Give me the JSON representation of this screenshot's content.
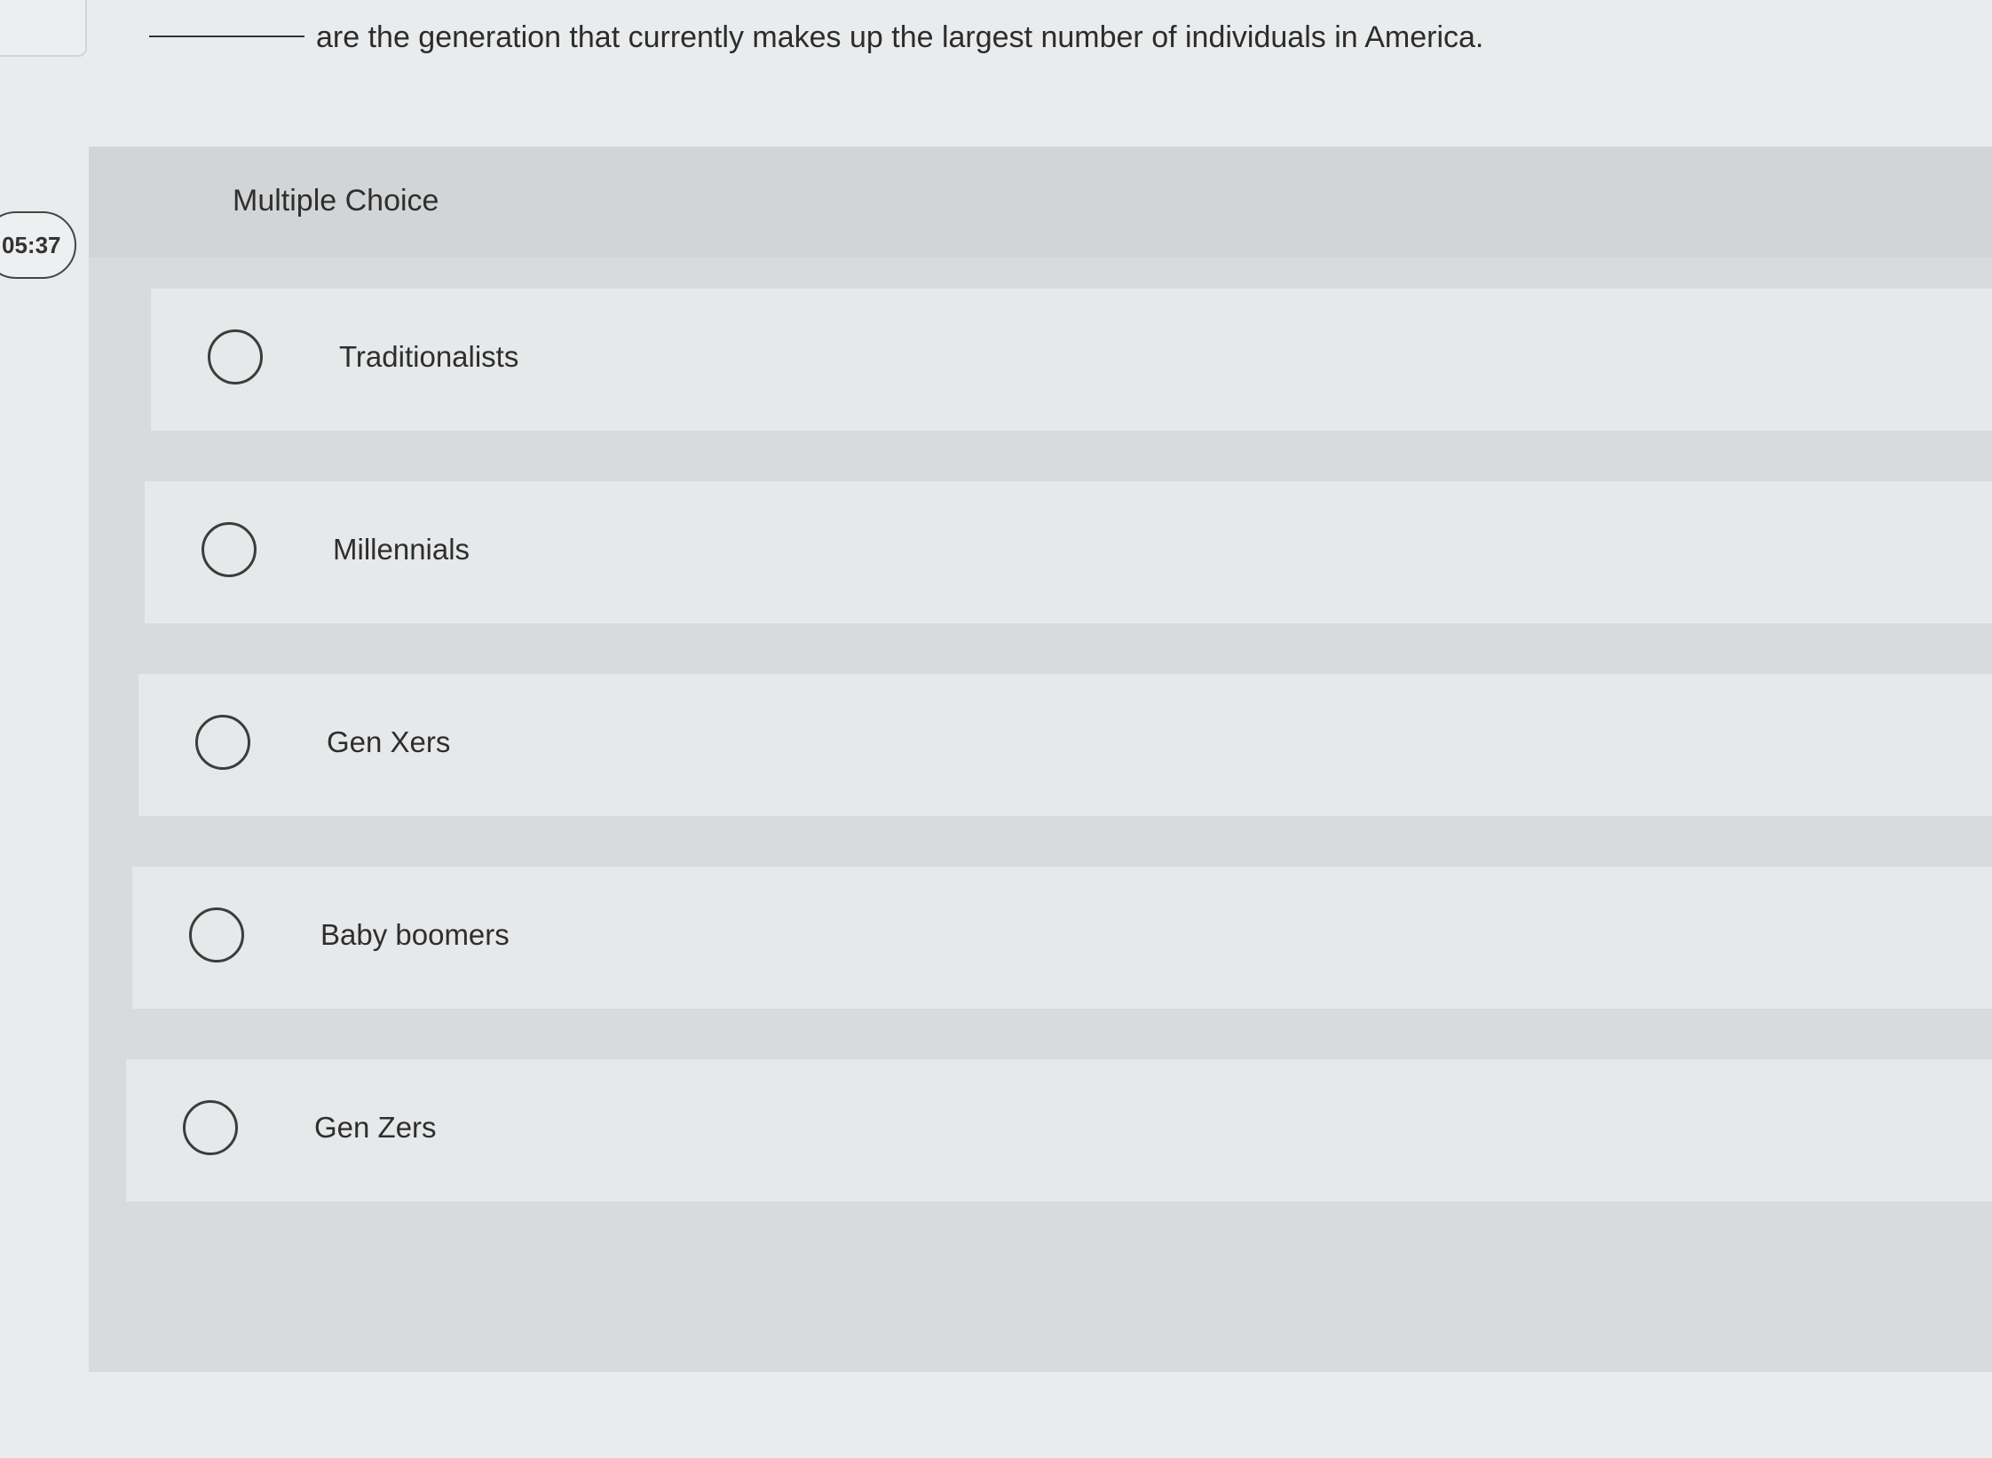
{
  "question": {
    "blank": "",
    "text": "are the generation that currently makes up the largest number of individuals in America."
  },
  "timer": {
    "value": "05:37"
  },
  "multiple_choice": {
    "header": "Multiple Choice",
    "options": [
      {
        "label": "Traditionalists",
        "selected": false
      },
      {
        "label": "Millennials",
        "selected": false
      },
      {
        "label": "Gen Xers",
        "selected": false
      },
      {
        "label": "Baby boomers",
        "selected": false
      },
      {
        "label": "Gen Zers",
        "selected": false
      }
    ]
  },
  "colors": {
    "page_background": "#e9ebec",
    "panel_background": "#d8dadc",
    "option_background": "#e6e8e9",
    "text": "#2a2a2a"
  }
}
